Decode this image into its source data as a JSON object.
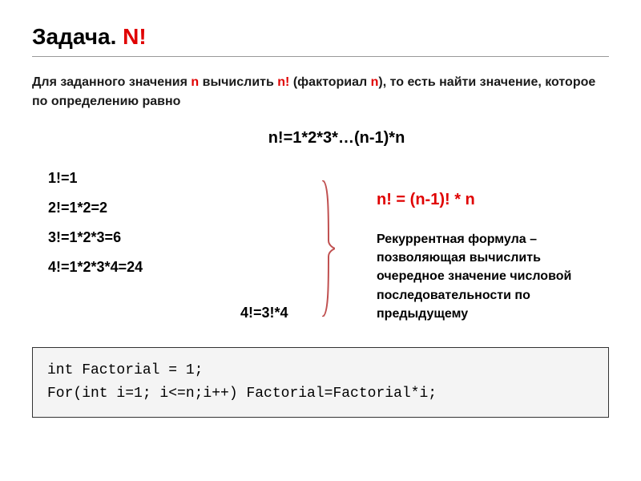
{
  "title": {
    "word1": "Задача",
    "dot": ". ",
    "word2": "N!"
  },
  "intro": {
    "part1": "Для заданного значения ",
    "n1": "n",
    "part2": " вычислить ",
    "nfact": "n!",
    "part3": " (факториал ",
    "n2": "n",
    "part4": "), то есть найти значение, которое по определению равно"
  },
  "formula_main": "n!=1*2*3*…(n-1)*n",
  "examples": {
    "e1": "1!=1",
    "e2": "2!=1*2=2",
    "e3": "3!=1*2*3=6",
    "e4": "4!=1*2*3*4=24"
  },
  "side_example": "4!=3!*4",
  "recurrent_formula": "n! = (n-1)! * n",
  "recurrent_desc": "Рекуррентная формула – позволяющая вычислить очередное значение числовой последовательности по предыдущему",
  "code": {
    "line1": "int Factorial = 1;",
    "line2": "For(int i=1; i<=n;i++) Factorial=Factorial*i;"
  }
}
